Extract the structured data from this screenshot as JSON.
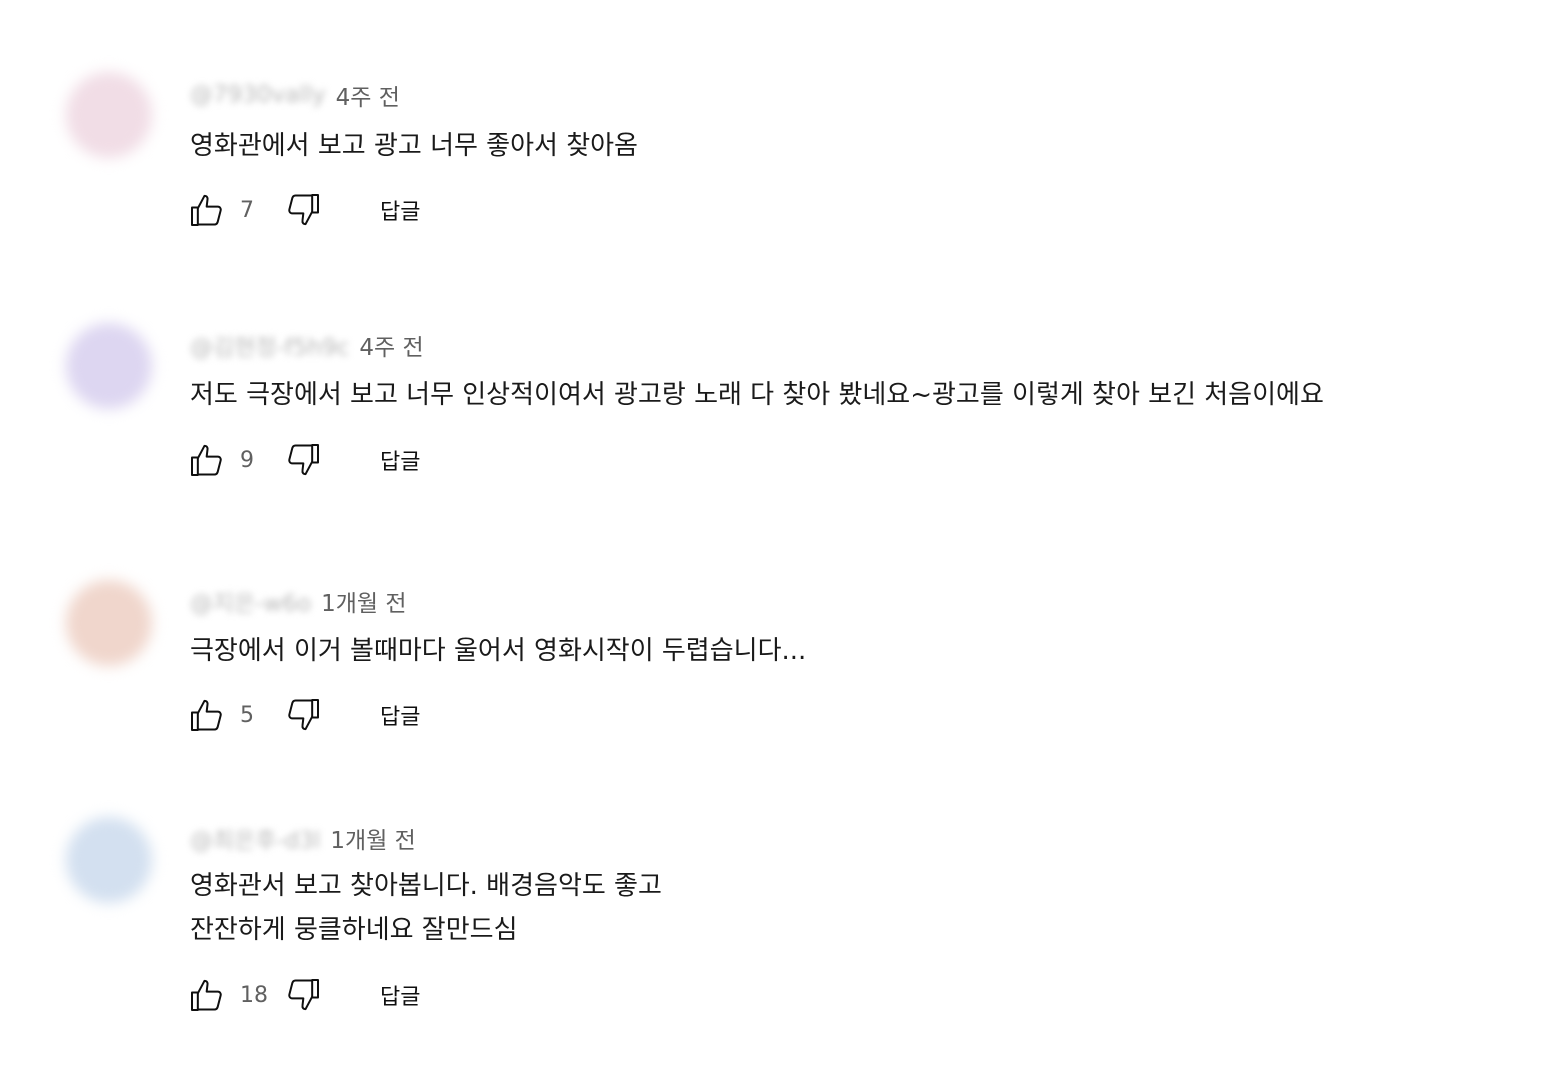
{
  "comments": [
    {
      "handle": "@7930vally",
      "time": "4주 전",
      "text_lines": [
        "영화관에서 보고 광고 너무 좋아서 찾아옴"
      ],
      "likes": "7",
      "reply_label": "답글",
      "avatar_color": "#f1dde6"
    },
    {
      "handle": "@김현정-f5h9c",
      "time": "4주 전",
      "text_lines": [
        "저도 극장에서 보고 너무 인상적이여서 광고랑 노래 다 찾아 봤네요~광고를 이렇게 찾아 보긴 처음이에요"
      ],
      "likes": "9",
      "reply_label": "답글",
      "avatar_color": "#ddd6f1"
    },
    {
      "handle": "@지은-w6o",
      "time": "1개월 전",
      "text_lines": [
        "극장에서 이거 볼때마다 울어서 영화시작이 두렵습니다..."
      ],
      "likes": "5",
      "reply_label": "답글",
      "avatar_color": "#f0d6cc"
    },
    {
      "handle": "@최은후-d3l",
      "time": "1개월 전",
      "text_lines": [
        "영화관서 보고 찾아봅니다. 배경음악도 좋고",
        "잔잔하게 뭉클하네요 잘만드심"
      ],
      "likes": "18",
      "reply_label": "답글",
      "avatar_color": "#d3e0f0"
    }
  ],
  "icons": {
    "like": "thumb-up-icon",
    "dislike": "thumb-down-icon"
  }
}
